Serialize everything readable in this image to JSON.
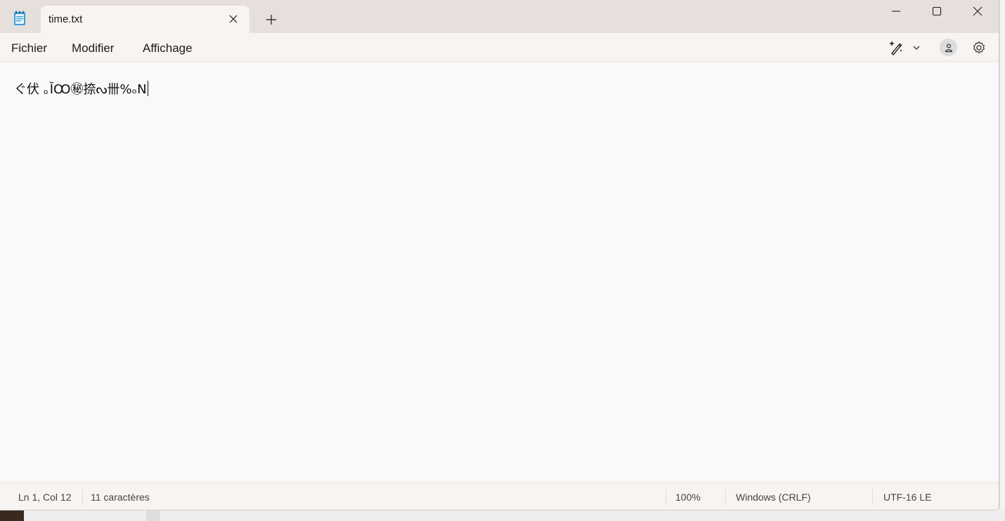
{
  "tab": {
    "title": "time.txt"
  },
  "menu": {
    "file": "Fichier",
    "edit": "Modifier",
    "view": "Affichage"
  },
  "editor": {
    "content": "ぐ伏 ｡ĬꝎ㊙捺ᔓ卌%ₒN"
  },
  "status": {
    "position": "Ln 1, Col 12",
    "chars": "11 caractères",
    "zoom": "100%",
    "line_ending": "Windows (CRLF)",
    "encoding": "UTF-16 LE"
  },
  "icons": {
    "app": "notepad-icon",
    "close_tab": "close-icon",
    "new_tab": "plus-icon",
    "minimize": "minimize-icon",
    "maximize": "maximize-icon",
    "close_window": "close-icon",
    "copilot": "sparkle-pen-icon",
    "dropdown": "chevron-down-icon",
    "account": "person-icon",
    "settings": "gear-icon"
  },
  "colors": {
    "titlebar": "#e6dfdc",
    "tab": "#f7f4f2",
    "editor": "#f9f9f9"
  }
}
